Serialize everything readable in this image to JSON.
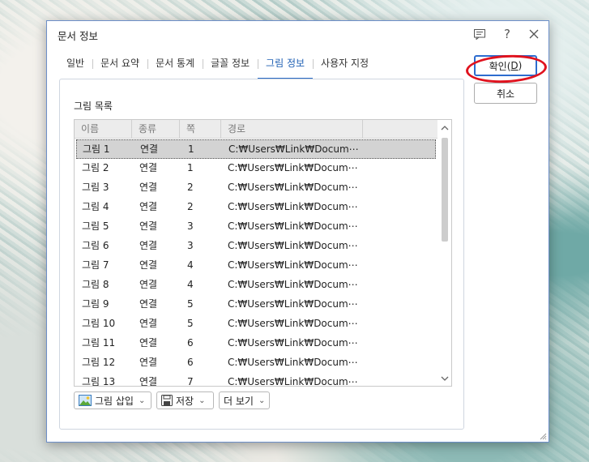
{
  "dialog": {
    "title": "문서 정보",
    "help_label": "?"
  },
  "tabs": [
    {
      "label": "일반"
    },
    {
      "label": "문서 요약"
    },
    {
      "label": "문서 통계"
    },
    {
      "label": "글꼴 정보"
    },
    {
      "label": "그림 정보",
      "active": true
    },
    {
      "label": "사용자 지정"
    }
  ],
  "picture_list": {
    "section_label": "그림 목록",
    "columns": [
      "이름",
      "종류",
      "쪽",
      "경로"
    ],
    "rows": [
      {
        "name": "그림 1",
        "type": "연결",
        "page": "1",
        "path": "C:₩Users₩Link₩Docum⋯"
      },
      {
        "name": "그림 2",
        "type": "연결",
        "page": "1",
        "path": "C:₩Users₩Link₩Docum⋯"
      },
      {
        "name": "그림 3",
        "type": "연결",
        "page": "2",
        "path": "C:₩Users₩Link₩Docum⋯"
      },
      {
        "name": "그림 4",
        "type": "연결",
        "page": "2",
        "path": "C:₩Users₩Link₩Docum⋯"
      },
      {
        "name": "그림 5",
        "type": "연결",
        "page": "3",
        "path": "C:₩Users₩Link₩Docum⋯"
      },
      {
        "name": "그림 6",
        "type": "연결",
        "page": "3",
        "path": "C:₩Users₩Link₩Docum⋯"
      },
      {
        "name": "그림 7",
        "type": "연결",
        "page": "4",
        "path": "C:₩Users₩Link₩Docum⋯"
      },
      {
        "name": "그림 8",
        "type": "연결",
        "page": "4",
        "path": "C:₩Users₩Link₩Docum⋯"
      },
      {
        "name": "그림 9",
        "type": "연결",
        "page": "5",
        "path": "C:₩Users₩Link₩Docum⋯"
      },
      {
        "name": "그림 10",
        "type": "연결",
        "page": "5",
        "path": "C:₩Users₩Link₩Docum⋯"
      },
      {
        "name": "그림 11",
        "type": "연결",
        "page": "6",
        "path": "C:₩Users₩Link₩Docum⋯"
      },
      {
        "name": "그림 12",
        "type": "연결",
        "page": "6",
        "path": "C:₩Users₩Link₩Docum⋯"
      },
      {
        "name": "그림 13",
        "type": "연결",
        "page": "7",
        "path": "C:₩Users₩Link₩Docum⋯"
      }
    ],
    "selected_index": 0
  },
  "footer_buttons": {
    "insert_picture": "그림 삽입",
    "save": "저장",
    "more": "더 보기"
  },
  "side_buttons": {
    "ok_label": "확인(",
    "ok_mnemonic": "D",
    "ok_suffix": ")",
    "cancel_label": "취소"
  },
  "colors": {
    "accent": "#2a6bc4",
    "selection": "#d3d3d3",
    "annotation": "#e0121e"
  }
}
